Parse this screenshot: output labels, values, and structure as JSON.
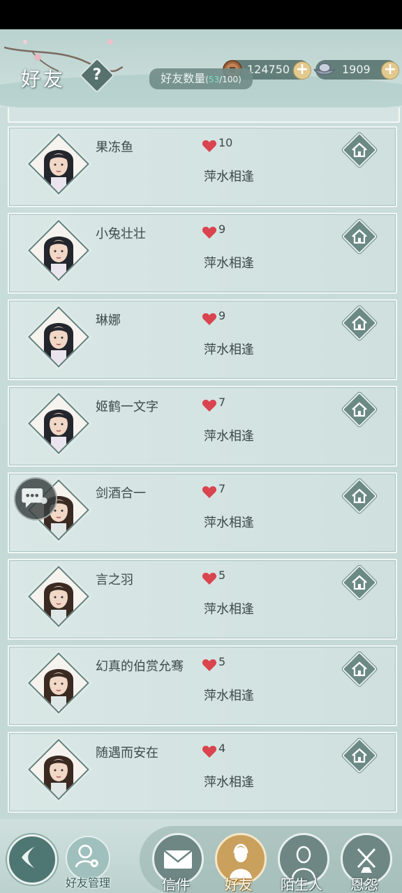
{
  "header": {
    "title": "好友",
    "help_label": "?",
    "coins": "124750",
    "silver": "1909",
    "plus_label": "+",
    "friend_count_label": "好友数量",
    "friend_count_current": "53",
    "friend_count_max": "100"
  },
  "friends": [
    {
      "name": "果冻鱼",
      "favor": "10",
      "relation": "萍水相逢",
      "portrait_icon": "female-portrait-icon"
    },
    {
      "name": "小兔壮壮",
      "favor": "9",
      "relation": "萍水相逢",
      "portrait_icon": "female-portrait-icon"
    },
    {
      "name": "琳娜",
      "favor": "9",
      "relation": "萍水相逢",
      "portrait_icon": "female-portrait-icon"
    },
    {
      "name": "姬鹤一文字",
      "favor": "7",
      "relation": "萍水相逢",
      "portrait_icon": "female-portrait-icon"
    },
    {
      "name": "剑酒合一",
      "favor": "7",
      "relation": "萍水相逢",
      "portrait_icon": "male-portrait-icon"
    },
    {
      "name": "言之羽",
      "favor": "5",
      "relation": "萍水相逢",
      "portrait_icon": "male-portrait-icon"
    },
    {
      "name": "幻真的伯赏允骞",
      "favor": "5",
      "relation": "萍水相逢",
      "portrait_icon": "male-portrait-icon"
    },
    {
      "name": "随遇而安在",
      "favor": "4",
      "relation": "萍水相逢",
      "portrait_icon": "male-portrait-icon"
    }
  ],
  "bottom_nav": {
    "manage_label": "好友管理",
    "tabs": [
      {
        "label": "信件",
        "icon": "envelope-icon"
      },
      {
        "label": "好友",
        "icon": "friend-portrait-icon"
      },
      {
        "label": "陌生人",
        "icon": "stranger-icon"
      },
      {
        "label": "恩怨",
        "icon": "feud-icon"
      }
    ],
    "active_tab": "好友"
  },
  "colors": {
    "accent": "#caa05d",
    "heart": "#d9444f",
    "count_highlight": "#7ee0c6",
    "panel": "#d5e4e2"
  }
}
